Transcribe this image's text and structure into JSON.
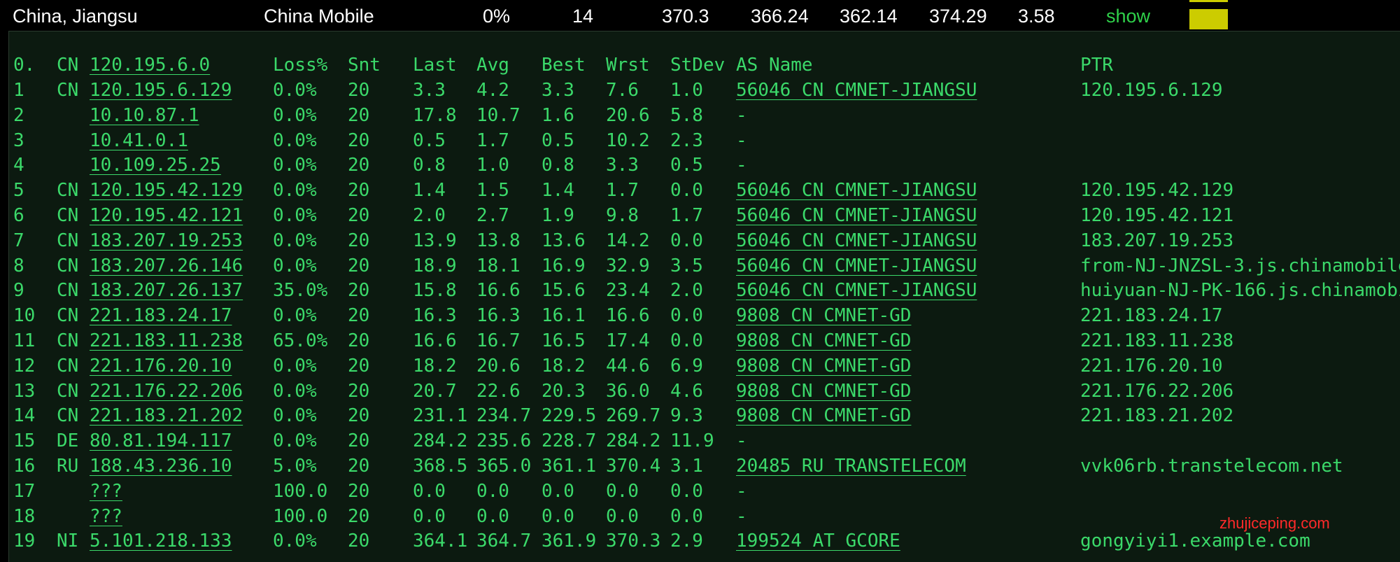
{
  "summary": {
    "location": "China, Jiangsu",
    "isp": "China Mobile",
    "loss": "0%",
    "hops": "14",
    "last": "370.3",
    "avg": "366.24",
    "best": "362.14",
    "worst": "374.29",
    "stdev": "3.58",
    "show_label": "show",
    "swatch_color": "#cccc00"
  },
  "header": {
    "num": "0.",
    "cc": "CN",
    "host": "120.195.6.0",
    "loss": "Loss%",
    "snt": "Snt",
    "last": "Last",
    "avg": "Avg",
    "best": "Best",
    "wrst": "Wrst",
    "stdev": "StDev",
    "as": "AS Name",
    "ptr": "PTR"
  },
  "hops": [
    {
      "num": "1",
      "cc": "CN",
      "host": "120.195.6.129",
      "loss": "0.0%",
      "snt": "20",
      "last": "3.3",
      "avg": "4.2",
      "best": "3.3",
      "wrst": "7.6",
      "stdev": "1.0",
      "as": "56046 CN CMNET-JIANGSU",
      "ptr": "120.195.6.129"
    },
    {
      "num": "2",
      "cc": "",
      "host": "10.10.87.1",
      "loss": "0.0%",
      "snt": "20",
      "last": "17.8",
      "avg": "10.7",
      "best": "1.6",
      "wrst": "20.6",
      "stdev": "5.8",
      "as": "-",
      "ptr": ""
    },
    {
      "num": "3",
      "cc": "",
      "host": "10.41.0.1",
      "loss": "0.0%",
      "snt": "20",
      "last": "0.5",
      "avg": "1.7",
      "best": "0.5",
      "wrst": "10.2",
      "stdev": "2.3",
      "as": "-",
      "ptr": ""
    },
    {
      "num": "4",
      "cc": "",
      "host": "10.109.25.25",
      "loss": "0.0%",
      "snt": "20",
      "last": "0.8",
      "avg": "1.0",
      "best": "0.8",
      "wrst": "3.3",
      "stdev": "0.5",
      "as": "-",
      "ptr": ""
    },
    {
      "num": "5",
      "cc": "CN",
      "host": "120.195.42.129",
      "loss": "0.0%",
      "snt": "20",
      "last": "1.4",
      "avg": "1.5",
      "best": "1.4",
      "wrst": "1.7",
      "stdev": "0.0",
      "as": "56046 CN CMNET-JIANGSU",
      "ptr": "120.195.42.129"
    },
    {
      "num": "6",
      "cc": "CN",
      "host": "120.195.42.121",
      "loss": "0.0%",
      "snt": "20",
      "last": "2.0",
      "avg": "2.7",
      "best": "1.9",
      "wrst": "9.8",
      "stdev": "1.7",
      "as": "56046 CN CMNET-JIANGSU",
      "ptr": "120.195.42.121"
    },
    {
      "num": "7",
      "cc": "CN",
      "host": "183.207.19.253",
      "loss": "0.0%",
      "snt": "20",
      "last": "13.9",
      "avg": "13.8",
      "best": "13.6",
      "wrst": "14.2",
      "stdev": "0.0",
      "as": "56046 CN CMNET-JIANGSU",
      "ptr": "183.207.19.253"
    },
    {
      "num": "8",
      "cc": "CN",
      "host": "183.207.26.146",
      "loss": "0.0%",
      "snt": "20",
      "last": "18.9",
      "avg": "18.1",
      "best": "16.9",
      "wrst": "32.9",
      "stdev": "3.5",
      "as": "56046 CN CMNET-JIANGSU",
      "ptr": "from-NJ-JNZSL-3.js.chinamobile"
    },
    {
      "num": "9",
      "cc": "CN",
      "host": "183.207.26.137",
      "loss": "35.0%",
      "snt": "20",
      "last": "15.8",
      "avg": "16.6",
      "best": "15.6",
      "wrst": "23.4",
      "stdev": "2.0",
      "as": "56046 CN CMNET-JIANGSU",
      "ptr": "huiyuan-NJ-PK-166.js.chinamobi"
    },
    {
      "num": "10",
      "cc": "CN",
      "host": "221.183.24.17",
      "loss": "0.0%",
      "snt": "20",
      "last": "16.3",
      "avg": "16.3",
      "best": "16.1",
      "wrst": "16.6",
      "stdev": "0.0",
      "as": "9808  CN CMNET-GD",
      "ptr": "221.183.24.17"
    },
    {
      "num": "11",
      "cc": "CN",
      "host": "221.183.11.238",
      "loss": "65.0%",
      "snt": "20",
      "last": "16.6",
      "avg": "16.7",
      "best": "16.5",
      "wrst": "17.4",
      "stdev": "0.0",
      "as": "9808  CN CMNET-GD",
      "ptr": "221.183.11.238"
    },
    {
      "num": "12",
      "cc": "CN",
      "host": "221.176.20.10",
      "loss": "0.0%",
      "snt": "20",
      "last": "18.2",
      "avg": "20.6",
      "best": "18.2",
      "wrst": "44.6",
      "stdev": "6.9",
      "as": "9808  CN CMNET-GD",
      "ptr": "221.176.20.10"
    },
    {
      "num": "13",
      "cc": "CN",
      "host": "221.176.22.206",
      "loss": "0.0%",
      "snt": "20",
      "last": "20.7",
      "avg": "22.6",
      "best": "20.3",
      "wrst": "36.0",
      "stdev": "4.6",
      "as": "9808  CN CMNET-GD",
      "ptr": "221.176.22.206"
    },
    {
      "num": "14",
      "cc": "CN",
      "host": "221.183.21.202",
      "loss": "0.0%",
      "snt": "20",
      "last": "231.1",
      "avg": "234.7",
      "best": "229.5",
      "wrst": "269.7",
      "stdev": "9.3",
      "as": "9808  CN CMNET-GD",
      "ptr": "221.183.21.202"
    },
    {
      "num": "15",
      "cc": "DE",
      "host": "80.81.194.117",
      "loss": "0.0%",
      "snt": "20",
      "last": "284.2",
      "avg": "235.6",
      "best": "228.7",
      "wrst": "284.2",
      "stdev": "11.9",
      "as": "-",
      "ptr": ""
    },
    {
      "num": "16",
      "cc": "RU",
      "host": "188.43.236.10",
      "loss": "5.0%",
      "snt": "20",
      "last": "368.5",
      "avg": "365.0",
      "best": "361.1",
      "wrst": "370.4",
      "stdev": "3.1",
      "as": "20485 RU TRANSTELECOM",
      "ptr": "vvk06rb.transtelecom.net"
    },
    {
      "num": "17",
      "cc": "",
      "host": "???",
      "loss": "100.0",
      "snt": "20",
      "last": "0.0",
      "avg": "0.0",
      "best": "0.0",
      "wrst": "0.0",
      "stdev": "0.0",
      "as": "-",
      "ptr": ""
    },
    {
      "num": "18",
      "cc": "",
      "host": "???",
      "loss": "100.0",
      "snt": "20",
      "last": "0.0",
      "avg": "0.0",
      "best": "0.0",
      "wrst": "0.0",
      "stdev": "0.0",
      "as": "-",
      "ptr": ""
    },
    {
      "num": "19",
      "cc": "NI",
      "host": "5.101.218.133",
      "loss": "0.0%",
      "snt": "20",
      "last": "364.1",
      "avg": "364.7",
      "best": "361.9",
      "wrst": "370.3",
      "stdev": "2.9",
      "as": "199524 AT GCORE",
      "ptr": "gongyiyi1.example.com"
    }
  ],
  "watermark": "zhujiceping.com"
}
